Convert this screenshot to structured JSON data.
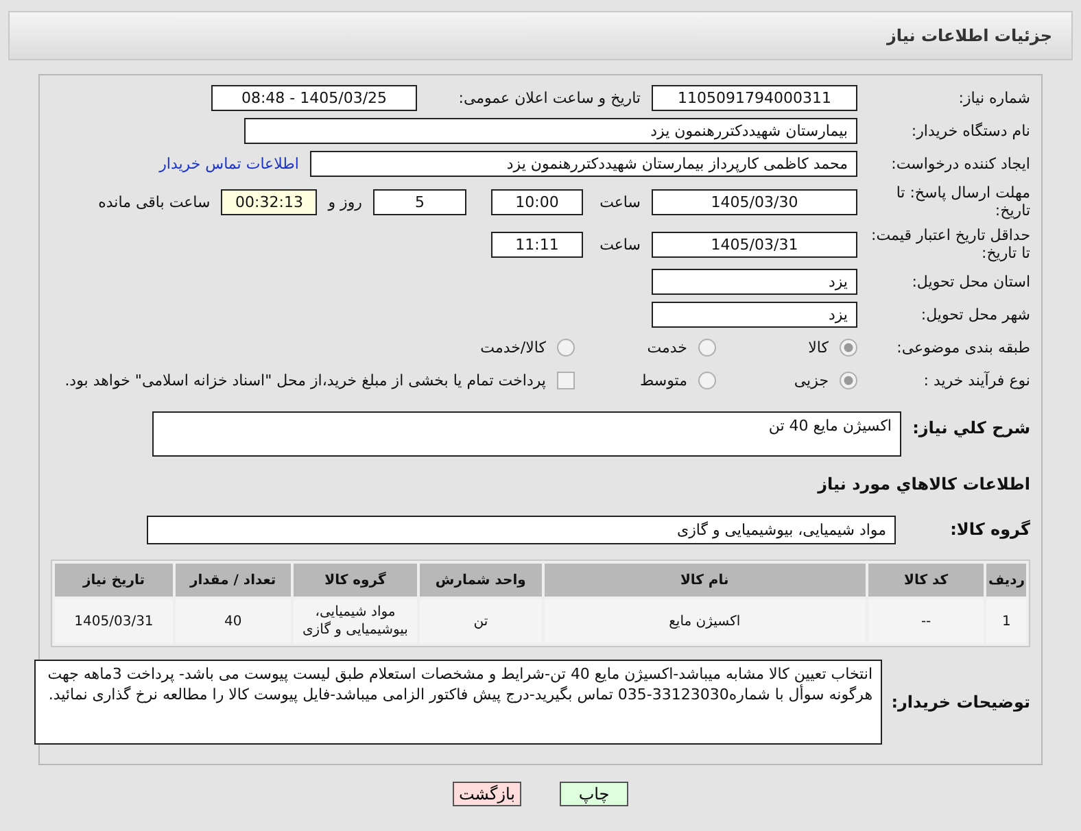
{
  "header": {
    "title": "جزئیات اطلاعات نیاز"
  },
  "need_number": {
    "label": "شماره نیاز:",
    "value": "1105091794000311"
  },
  "announce": {
    "label": "تاریخ و ساعت اعلان عمومی:",
    "value": "1405/03/25 - 08:48"
  },
  "buyer_org": {
    "label": "نام دستگاه خریدار:",
    "value": "بیمارستان شهیددکتررهنمون یزد"
  },
  "requester": {
    "label": "ایجاد کننده درخواست:",
    "value": "محمد کاظمی کارپرداز بیمارستان شهیددکتررهنمون یزد",
    "link": "اطلاعات تماس خریدار"
  },
  "deadline": {
    "label": "مهلت ارسال پاسخ: تا تاریخ:",
    "date": "1405/03/30",
    "time_label": "ساعت",
    "time": "10:00",
    "days": "5",
    "days_label": "روز و",
    "remaining": "00:32:13",
    "remaining_label": "ساعت باقی مانده"
  },
  "validity": {
    "label": "حداقل تاریخ اعتبار قیمت: تا تاریخ:",
    "date": "1405/03/31",
    "time_label": "ساعت",
    "time": "11:11"
  },
  "province": {
    "label": "استان محل تحویل:",
    "value": "یزد"
  },
  "city": {
    "label": "شهر محل تحویل:",
    "value": "یزد"
  },
  "category": {
    "label": "طبقه بندی موضوعی:",
    "options": [
      {
        "label": "کالا",
        "selected": true
      },
      {
        "label": "خدمت",
        "selected": false
      },
      {
        "label": "کالا/خدمت",
        "selected": false
      }
    ]
  },
  "process": {
    "label": "نوع فرآیند خرید :",
    "options": [
      {
        "label": "جزیی",
        "selected": true
      },
      {
        "label": "متوسط",
        "selected": false
      }
    ],
    "payment": {
      "label": "پرداخت تمام یا بخشی از مبلغ خرید،از محل \"اسناد خزانه اسلامی\" خواهد بود.",
      "checked": false
    }
  },
  "summary": {
    "label": "شرح کلي نیاز:",
    "value": "اکسیژن مایع 40 تن"
  },
  "goods_title": "اطلاعات کالاهاي مورد نیاز",
  "goods_group": {
    "label": "گروه کالا:",
    "value": "مواد شیمیایی، بیوشیمیایی و  گازی"
  },
  "table": {
    "columns": [
      "ردیف",
      "کد کالا",
      "نام کالا",
      "واحد شمارش",
      "گروه کالا",
      "تعداد / مقدار",
      "تاریخ نیاز"
    ],
    "rows": [
      [
        "1",
        "--",
        "اکسیژن مایع",
        "تن",
        "مواد شیمیایی، بیوشیمیایی و گازی",
        "40",
        "1405/03/31"
      ]
    ]
  },
  "notes": {
    "label": "توضیحات خریدار:",
    "value": "انتخاب تعیین کالا مشابه میباشد-اکسیژن مایع 40 تن-شرایط و مشخصات استعلام طبق لیست پیوست می باشد- پرداخت 3ماهه جهت هرگونه سوأل با شماره33123030-035 تماس بگیرید-درج پیش فاکتور الزامی میباشد-فایل پیوست کالا را مطالعه نرخ گذاری نمائید."
  },
  "buttons": [
    {
      "label": "چاپ",
      "kind": "print"
    },
    {
      "label": "بازگشت",
      "kind": "back"
    }
  ]
}
